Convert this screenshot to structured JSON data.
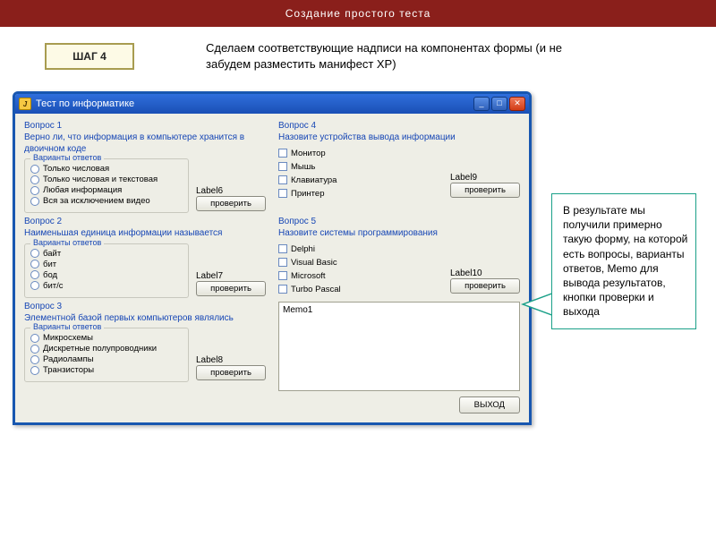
{
  "header": {
    "title": "Создание простого теста"
  },
  "step": {
    "label": "ШАГ 4"
  },
  "intro": "   Сделаем соответствующие надписи на компонентах формы (и не забудем разместить манифест XP)",
  "window": {
    "title": "Тест по информатике",
    "icon_letter": "J",
    "groupbox_legend": "Варианты ответов",
    "check_button": "проверить",
    "exit_button": "ВЫХОД",
    "memo_text": "Memo1",
    "questions": [
      {
        "num": "Вопрос 1",
        "text": "Верно ли, что информация в компьютере хранится в двоичном коде",
        "kind": "radio",
        "options": [
          "Только числовая",
          "Только числовая и текстовая",
          "Любая информация",
          "Вся за исключением видео"
        ],
        "label": "Label6"
      },
      {
        "num": "Вопрос 2",
        "text": "Наименьшая единица информации называется",
        "kind": "radio",
        "options": [
          "байт",
          "бит",
          "бод",
          "бит/с"
        ],
        "label": "Label7"
      },
      {
        "num": "Вопрос 3",
        "text": "Элементной базой первых компьютеров являлись",
        "kind": "radio",
        "options": [
          "Микросхемы",
          "Дискретные полупроводники",
          "Радиолампы",
          "Транзисторы"
        ],
        "label": "Label8"
      },
      {
        "num": "Вопрос 4",
        "text": "Назовите устройства вывода информации",
        "kind": "checkbox",
        "options": [
          "Монитор",
          "Мышь",
          "Клавиатура",
          "Принтер"
        ],
        "label": "Label9"
      },
      {
        "num": "Вопрос 5",
        "text": "Назовите системы программирования",
        "kind": "checkbox",
        "options": [
          "Delphi",
          "Visual Basic",
          "Microsoft",
          "Turbo Pascal"
        ],
        "label": "Label10"
      }
    ]
  },
  "callout": "   В результате мы получили примерно такую форму, на которой есть вопросы, варианты ответов, Memo для вывода результатов,  кнопки проверки и выхода"
}
